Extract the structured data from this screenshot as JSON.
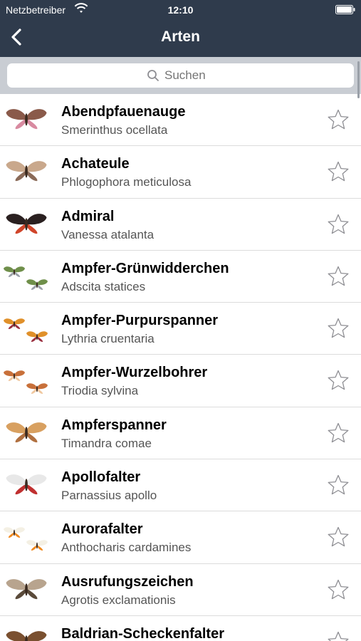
{
  "status": {
    "carrier": "Netzbetreiber",
    "time": "12:10",
    "wifi_icon": "wifi-icon",
    "battery_icon": "battery-icon"
  },
  "nav": {
    "title": "Arten",
    "back_icon": "chevron-left-icon"
  },
  "search": {
    "placeholder": "Suchen",
    "value": "",
    "icon": "search-icon"
  },
  "colors": {
    "navbar": "#2f3b4c",
    "search_bar_bg": "#c9cdd3",
    "star_outline": "#8e8e93"
  },
  "species": [
    {
      "name": "Abendpfauenauge",
      "scientific": "Smerinthus ocellata",
      "favorite": false,
      "wing": "#8a5a4a",
      "accent": "#d88aa0"
    },
    {
      "name": "Achateule",
      "scientific": "Phlogophora meticulosa",
      "favorite": false,
      "wing": "#c9a88c",
      "accent": "#8a6a58"
    },
    {
      "name": "Admiral",
      "scientific": "Vanessa atalanta",
      "favorite": false,
      "wing": "#2a2020",
      "accent": "#d0452a"
    },
    {
      "name": "Ampfer-Grünwidderchen",
      "scientific": "Adscita statices",
      "favorite": false,
      "wing": "#6f8f4a",
      "accent": "#9aa0a8"
    },
    {
      "name": "Ampfer-Purpurspanner",
      "scientific": "Lythria cruentaria",
      "favorite": false,
      "wing": "#e0902a",
      "accent": "#9a3040"
    },
    {
      "name": "Ampfer-Wurzelbohrer",
      "scientific": "Triodia sylvina",
      "favorite": false,
      "wing": "#c8703a",
      "accent": "#f0c8a0"
    },
    {
      "name": "Ampferspanner",
      "scientific": "Timandra comae",
      "favorite": false,
      "wing": "#d8a060",
      "accent": "#b07040"
    },
    {
      "name": "Apollofalter",
      "scientific": "Parnassius apollo",
      "favorite": false,
      "wing": "#e8e8e8",
      "accent": "#c03030"
    },
    {
      "name": "Aurorafalter",
      "scientific": "Anthocharis cardamines",
      "favorite": false,
      "wing": "#f4f0e4",
      "accent": "#f08a20"
    },
    {
      "name": "Ausrufungszeichen",
      "scientific": "Agrotis exclamationis",
      "favorite": false,
      "wing": "#b8a48e",
      "accent": "#5a4a3a"
    },
    {
      "name": "Baldrian-Scheckenfalter",
      "scientific": "",
      "favorite": false,
      "wing": "#7a5030",
      "accent": "#d89a50"
    }
  ]
}
